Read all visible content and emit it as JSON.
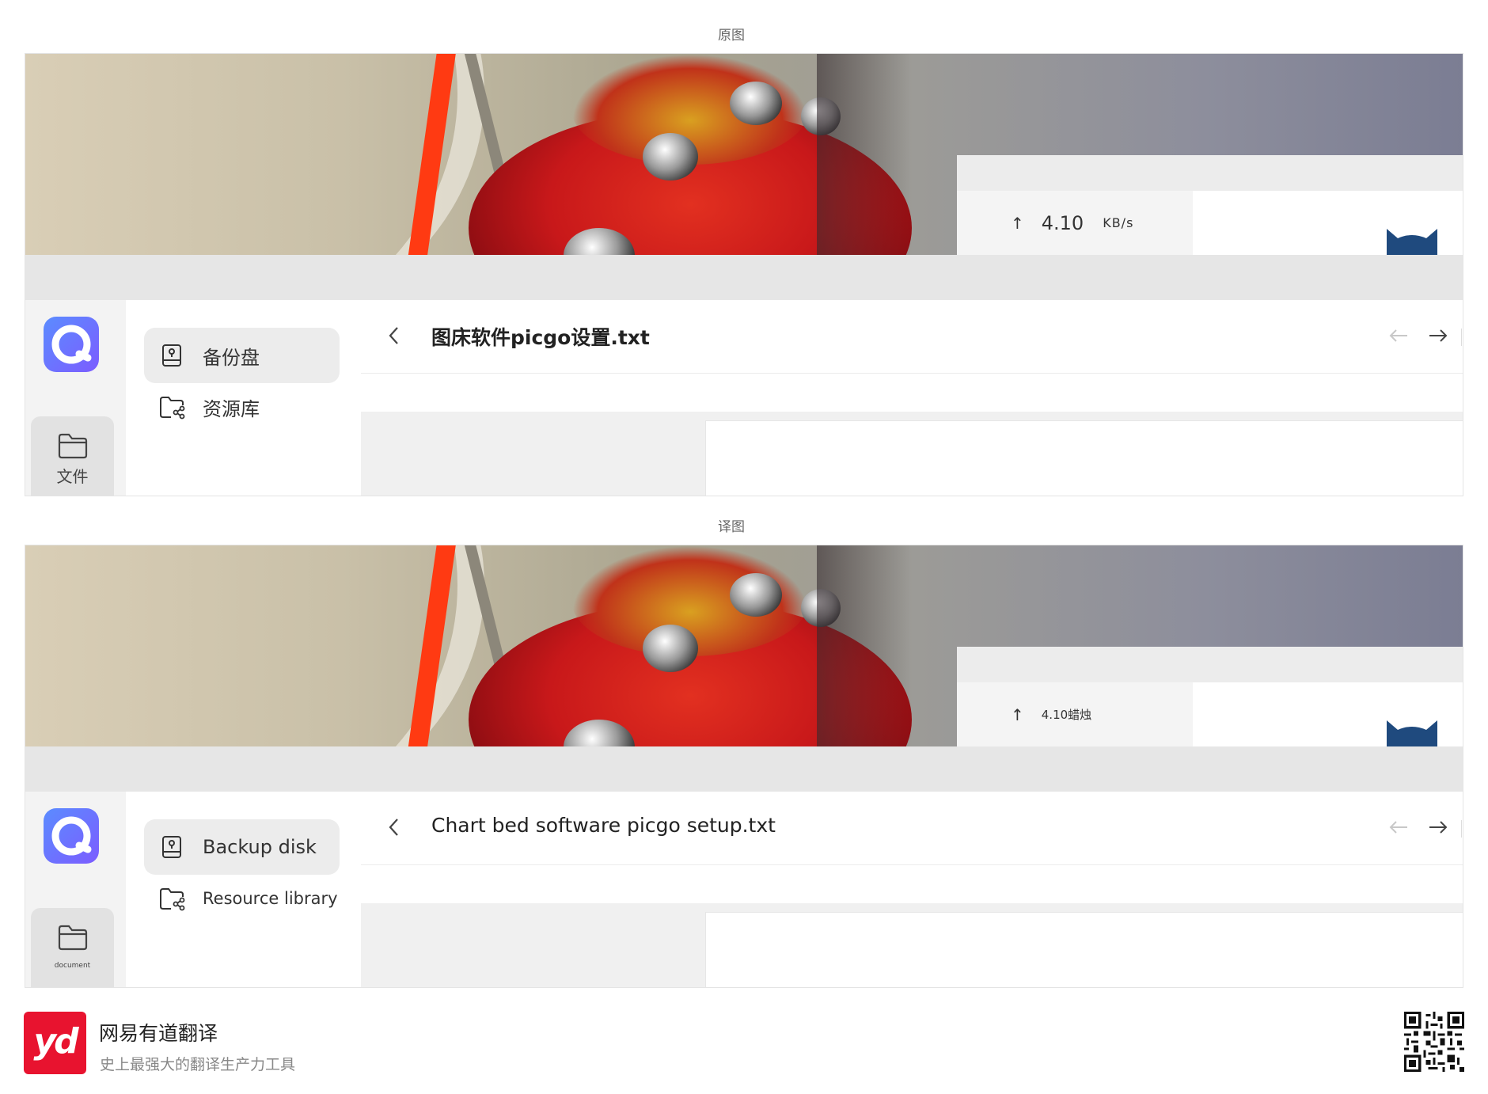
{
  "sections": {
    "original_label": "原图",
    "translated_label": "译图"
  },
  "original": {
    "upload_speed": {
      "arrow": "↑",
      "value": "4.10",
      "unit": "KB/s"
    },
    "rail": {
      "files_label": "文件"
    },
    "nav": {
      "backup_label": "备份盘",
      "library_label": "资源库"
    },
    "file": {
      "title": "图床软件picgo设置.txt"
    }
  },
  "translated": {
    "upload_speed": {
      "arrow": "↑",
      "text": "4.10蜡烛"
    },
    "rail": {
      "files_label": "document"
    },
    "nav": {
      "backup_label": "Backup disk",
      "library_label": "Resource library"
    },
    "file": {
      "title": "Chart bed software picgo setup.txt"
    }
  },
  "footer": {
    "logo_text": "yd",
    "brand_name": "网易有道翻译",
    "tagline": "史上最强大的翻译生产力工具"
  },
  "icons": {
    "back": "chevron-left-icon",
    "prev": "arrow-left-icon",
    "next": "arrow-right-icon",
    "backup": "backup-disk-icon",
    "library": "shared-folder-icon",
    "files": "folder-icon"
  },
  "colors": {
    "brand_red": "#e8132f",
    "app_blue": "#5b8cff",
    "cat_blue": "#1f4a7e"
  }
}
